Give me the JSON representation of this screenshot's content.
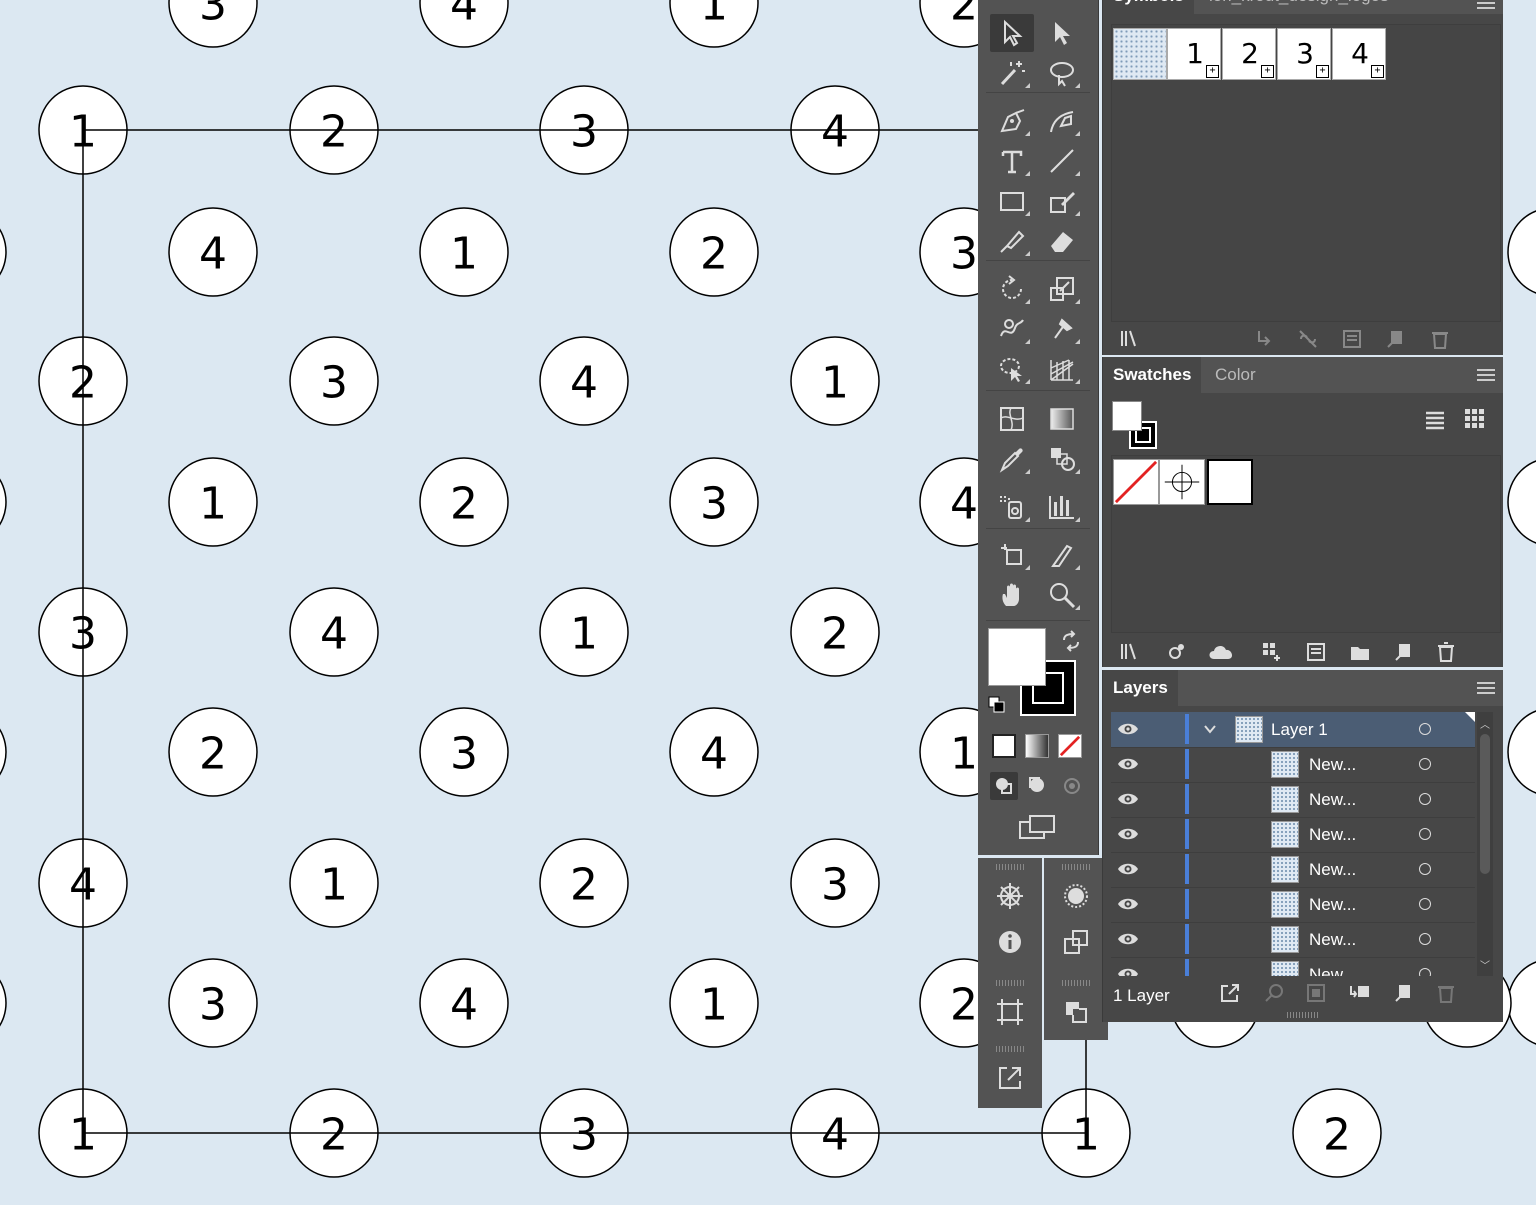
{
  "canvas": {
    "background": "#dce8f2",
    "circle_numbers": {
      "row_y67_partial": [
        "3",
        "4",
        "1",
        "2"
      ],
      "row_y130": [
        "1",
        "2",
        "3",
        "4"
      ],
      "row_y250": [
        "4",
        "1",
        "2",
        "3"
      ],
      "row_y380": [
        "2",
        "3",
        "4",
        "1"
      ],
      "row_y500": [
        "1",
        "2",
        "3",
        "4"
      ],
      "row_y630": [
        "3",
        "4",
        "1",
        "2"
      ],
      "row_y750": [
        "2",
        "3",
        "4",
        "1"
      ],
      "row_y880": [
        "4",
        "1",
        "2",
        "3"
      ],
      "row_y1000": [
        "3",
        "4",
        "1",
        "2"
      ],
      "row_y1130": [
        "1",
        "2",
        "3",
        "4",
        "1",
        "2"
      ]
    }
  },
  "symbols_panel": {
    "tab_symbols": "Symbols",
    "tab_library": "lori_krout_design_logos",
    "symbols": [
      "1",
      "2",
      "3",
      "4"
    ]
  },
  "swatches_panel": {
    "tab_swatches": "Swatches",
    "tab_color": "Color"
  },
  "layers_panel": {
    "tab_layers": "Layers",
    "layer_name": "Layer 1",
    "sublayers": [
      "New...",
      "New...",
      "New...",
      "New...",
      "New...",
      "New...",
      "New..."
    ],
    "footer": "1 Layer"
  },
  "colors": {
    "panel_bg": "#474747",
    "tools_bg": "#535353",
    "selection": "#4b5d74",
    "layer_color": "#4a7fd8"
  }
}
